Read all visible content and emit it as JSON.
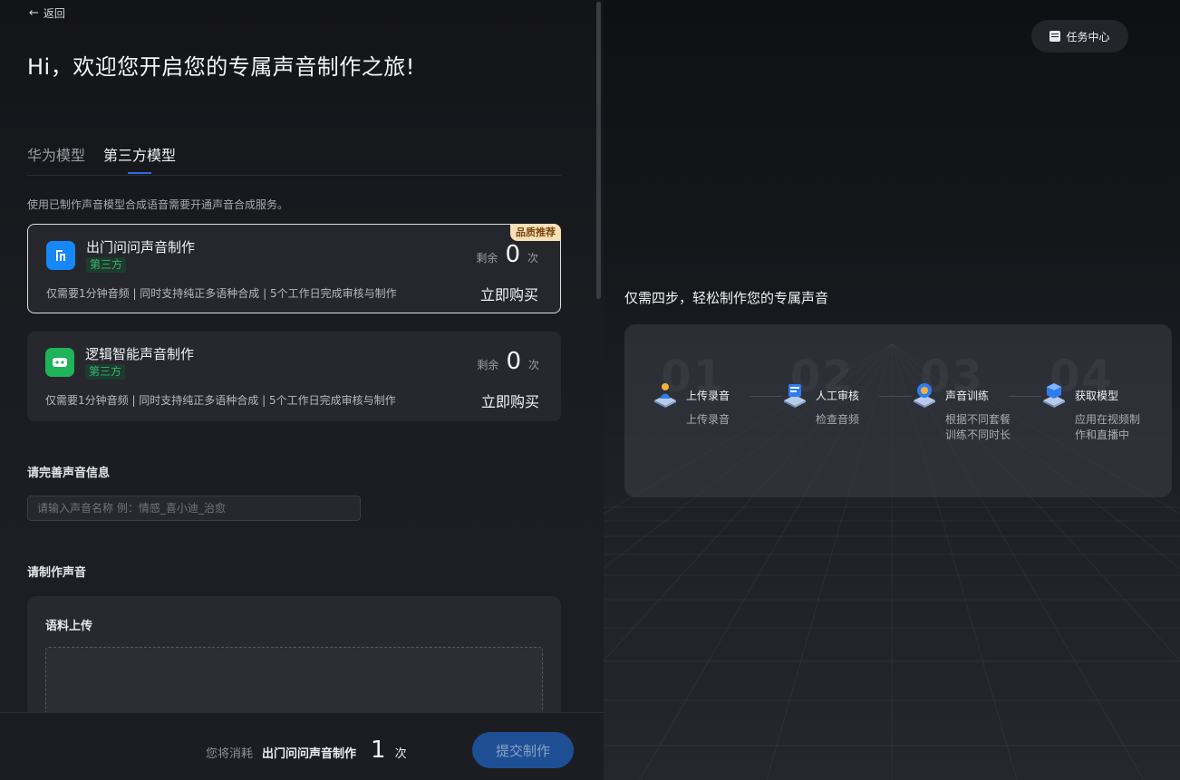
{
  "nav": {
    "back_label": "返回"
  },
  "hero": {
    "title": "Hi，欢迎您开启您的专属声音制作之旅!"
  },
  "tabs": [
    {
      "label": "华为模型",
      "active": false
    },
    {
      "label": "第三方模型",
      "active": true
    }
  ],
  "notice": "使用已制作声音模型合成语音需要开通声音合成服务。",
  "cards": [
    {
      "title": "出门问问声音制作",
      "tag": "第三方",
      "badge": "品质推荐",
      "remain_label": "剩余",
      "remain_count": "0",
      "remain_unit": "次",
      "desc": "仅需要1分钟音频 | 同时支持纯正多语种合成 | 5个工作日完成审核与制作",
      "buy_label": "立即购买",
      "selected": true,
      "icon": "mobvoi-logo-icon",
      "color": "#1687f6"
    },
    {
      "title": "逻辑智能声音制作",
      "tag": "第三方",
      "remain_label": "剩余",
      "remain_count": "0",
      "remain_unit": "次",
      "desc": "仅需要1分钟音频 | 同时支持纯正多语种合成 | 5个工作日完成审核与制作",
      "buy_label": "立即购买",
      "selected": false,
      "icon": "robot-face-icon",
      "color": "#1fb35a"
    }
  ],
  "voice_info": {
    "section_title": "请完善声音信息",
    "name_placeholder": "请输入声音名称 例：情感_喜小迪_治愈"
  },
  "make_voice": {
    "section_title": "请制作声音",
    "upload_title": "语料上传"
  },
  "footer": {
    "cost_prefix": "您将消耗",
    "cost_model": "出门问问声音制作",
    "cost_count": "1",
    "cost_unit": "次",
    "submit_label": "提交制作"
  },
  "right": {
    "task_center_label": "任务中心",
    "steps_title": "仅需四步，轻松制作您的专属声音",
    "steps": [
      {
        "num": "01",
        "name": "上传录音",
        "desc": "上传录音",
        "icon": "upload-user-icon"
      },
      {
        "num": "02",
        "name": "人工审核",
        "desc": "检查音频",
        "icon": "review-screen-icon"
      },
      {
        "num": "03",
        "name": "声音训练",
        "desc": "根据不同套餐训练不同时长",
        "icon": "training-globe-icon"
      },
      {
        "num": "04",
        "name": "获取模型",
        "desc": "应用在视频制作和直播中",
        "icon": "model-cube-icon"
      }
    ]
  },
  "colors": {
    "accent": "#2f6bd9",
    "submit_disabled": "#1e4f94",
    "badge": "#f7dfb6",
    "tag_green": "#37b56c"
  }
}
